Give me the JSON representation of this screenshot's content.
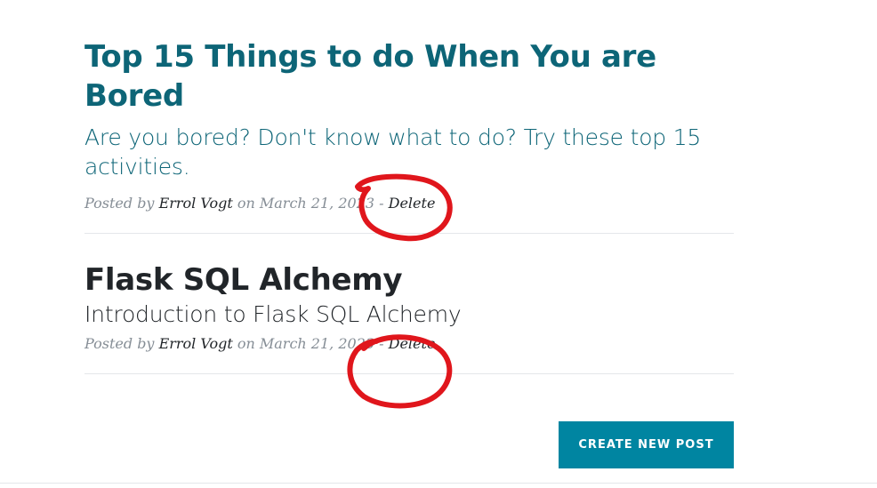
{
  "posts": [
    {
      "title": "Top 15 Things to do When You are Bored",
      "subtitle": "Are you bored? Don't know what to do? Try these top 15 activities.",
      "meta_prefix": "Posted by ",
      "author": "Errol Vogt",
      "meta_on": " on ",
      "date": "March 21, 2023",
      "meta_sep": " - ",
      "delete_label": "Delete"
    },
    {
      "title": "Flask SQL Alchemy",
      "subtitle": "Introduction to Flask SQL Alchemy",
      "meta_prefix": "Posted by ",
      "author": "Errol Vogt",
      "meta_on": " on ",
      "date": "March 21, 2023",
      "meta_sep": " - ",
      "delete_label": "Delete"
    }
  ],
  "pager": {
    "create_label": "Create New Post"
  },
  "colors": {
    "title_hover": "#0d6577",
    "title_default": "#212529",
    "meta": "#868e96",
    "button": "#0085a1",
    "annotation": "#e0161c"
  },
  "icons": {
    "annotation_circle": "hand-drawn-red-circle"
  }
}
